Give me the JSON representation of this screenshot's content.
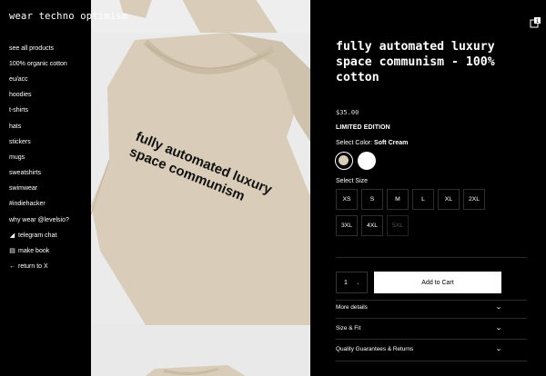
{
  "brand": "wear techno optimism",
  "nav": [
    {
      "label": "see all products",
      "icon": ""
    },
    {
      "label": "100% organic cotton",
      "icon": ""
    },
    {
      "label": "eu/acc",
      "icon": ""
    },
    {
      "label": "hoodies",
      "icon": ""
    },
    {
      "label": "t-shirts",
      "icon": ""
    },
    {
      "label": "hats",
      "icon": ""
    },
    {
      "label": "stickers",
      "icon": ""
    },
    {
      "label": "mugs",
      "icon": ""
    },
    {
      "label": "sweatshirts",
      "icon": ""
    },
    {
      "label": "swimwear",
      "icon": ""
    },
    {
      "label": "#indiehacker",
      "icon": ""
    },
    {
      "label": "why wear @levelsio?",
      "icon": ""
    },
    {
      "label": "telegram chat",
      "icon": "telegram-icon"
    },
    {
      "label": "make book",
      "icon": "book-icon"
    },
    {
      "label": "return to X",
      "icon": "back-arrow-icon"
    }
  ],
  "gallery": {
    "shirt_text_line1": "fully automated luxury",
    "shirt_text_line2": "space communism",
    "shirt_color": "#d9cdb9"
  },
  "cart": {
    "count": "1",
    "icon": "cart-icon"
  },
  "product": {
    "title": "fully automated luxury space communism - 100% cotton",
    "price": "$35.00",
    "badge": "LIMITED EDITION",
    "color_label": "Select Color:",
    "color_selected": "Soft Cream",
    "swatches": [
      {
        "name": "Soft Cream",
        "hex": "#d9cdb9",
        "selected": true
      },
      {
        "name": "White",
        "hex": "#ffffff",
        "selected": false
      }
    ],
    "size_label": "Select Size",
    "sizes": [
      {
        "label": "XS",
        "enabled": true
      },
      {
        "label": "S",
        "enabled": true
      },
      {
        "label": "M",
        "enabled": true
      },
      {
        "label": "L",
        "enabled": true
      },
      {
        "label": "XL",
        "enabled": true
      },
      {
        "label": "2XL",
        "enabled": true
      },
      {
        "label": "3XL",
        "enabled": true
      },
      {
        "label": "4XL",
        "enabled": true
      },
      {
        "label": "5XL",
        "enabled": false
      }
    ],
    "quantity": "1",
    "add_to_cart": "Add to Cart",
    "accordions": [
      "More details",
      "Size & Fit",
      "Quality Guarantees & Returns"
    ]
  }
}
